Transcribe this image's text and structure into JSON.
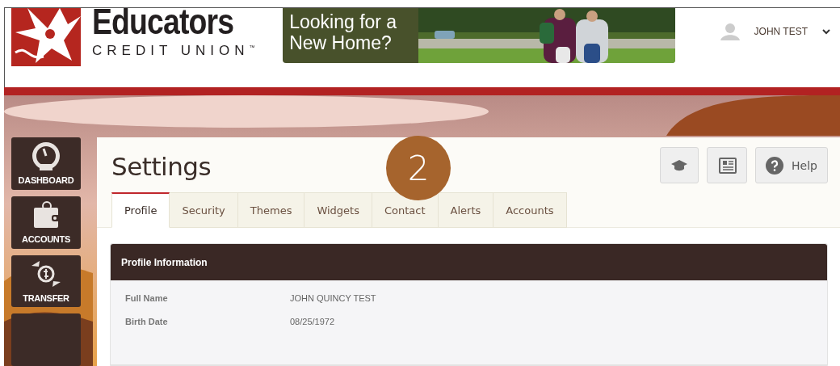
{
  "header": {
    "brand": {
      "name": "Educators",
      "subtitle": "CREDIT UNION",
      "trademark": "™"
    },
    "ad": {
      "text": "Looking for a New Home?"
    },
    "user": {
      "name": "JOHN TEST"
    }
  },
  "sidebar": {
    "items": [
      {
        "label": "DASHBOARD",
        "kind": "gauge"
      },
      {
        "label": "ACCOUNTS",
        "kind": "wallet"
      },
      {
        "label": "TRANSFER",
        "kind": "transfer"
      },
      {
        "kind": "blank"
      }
    ]
  },
  "page": {
    "title": "Settings",
    "step_badge": "2",
    "tool_buttons": [
      {
        "kind": "cap"
      },
      {
        "kind": "news"
      },
      {
        "kind": "help",
        "label": "Help"
      }
    ]
  },
  "tabs": [
    {
      "label": "Profile",
      "selected": true
    },
    {
      "label": "Security",
      "selected": false
    },
    {
      "label": "Themes",
      "selected": false
    },
    {
      "label": "Widgets",
      "selected": false
    },
    {
      "label": "Contact",
      "selected": false
    },
    {
      "label": "Alerts",
      "selected": false
    },
    {
      "label": "Accounts",
      "selected": false
    }
  ],
  "profile_panel": {
    "title": "Profile Information",
    "fields": [
      {
        "label": "Full Name",
        "value": "JOHN QUINCY TEST"
      },
      {
        "label": "Birth Date",
        "value": "08/25/1972"
      }
    ]
  }
}
